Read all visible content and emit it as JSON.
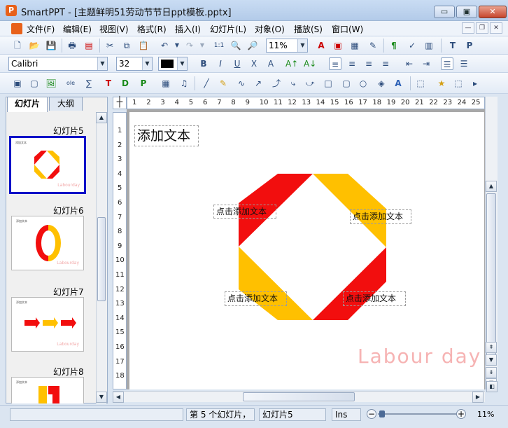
{
  "window": {
    "app_logo": "P",
    "title": "SmartPPT - [主题鲜明51劳动节节日ppt模板.pptx]",
    "minimize": "▭",
    "restore": "▣",
    "close": "✕"
  },
  "menu": [
    {
      "name": "menu-file",
      "label": "文件(F)"
    },
    {
      "name": "menu-edit",
      "label": "编辑(E)"
    },
    {
      "name": "menu-view",
      "label": "视图(V)"
    },
    {
      "name": "menu-format",
      "label": "格式(R)"
    },
    {
      "name": "menu-insert",
      "label": "插入(I)"
    },
    {
      "name": "menu-slide",
      "label": "幻灯片(L)"
    },
    {
      "name": "menu-object",
      "label": "对象(O)"
    },
    {
      "name": "menu-play",
      "label": "播放(S)"
    },
    {
      "name": "menu-window",
      "label": "窗口(W)"
    }
  ],
  "toolbar": {
    "zoom": "11%",
    "font_family": "Calibri",
    "font_size": "32"
  },
  "panel": {
    "tab_slides": "幻灯片",
    "tab_outline": "大纲"
  },
  "thumbnails": [
    {
      "label": "幻灯片5",
      "selected": true
    },
    {
      "label": "幻灯片6",
      "selected": false
    },
    {
      "label": "幻灯片7",
      "selected": false
    },
    {
      "label": "幻灯片8",
      "selected": false
    }
  ],
  "thumb_texts": {
    "title": "添加文本",
    "placeholder": "点击添加文本",
    "watermark": "Labourday"
  },
  "hruler_labels": [
    "1",
    "2",
    "3",
    "4",
    "5",
    "6",
    "7",
    "8",
    "9",
    "10",
    "11",
    "12",
    "13",
    "14",
    "15",
    "16",
    "17",
    "18",
    "19",
    "20",
    "21",
    "22",
    "23",
    "24",
    "25"
  ],
  "vruler_labels": [
    "1",
    "2",
    "3",
    "4",
    "5",
    "6",
    "7",
    "8",
    "9",
    "10",
    "11",
    "12",
    "13",
    "14",
    "15",
    "16",
    "17",
    "18"
  ],
  "slide": {
    "title": "添加文本",
    "text_top_left": "点击添加文本",
    "text_top_right": "点击添加文本",
    "text_bottom_left": "点击添加文本",
    "text_bottom_right": "点击添加文本",
    "watermark": "Labour day"
  },
  "colors": {
    "red": "#f20e0e",
    "yellow": "#ffc000"
  },
  "status": {
    "slide_of": "第 5 个幻灯片，",
    "slide_name": "幻灯片5",
    "ins": "Ins",
    "zoom": "11%",
    "zoom_level": 0.02
  }
}
